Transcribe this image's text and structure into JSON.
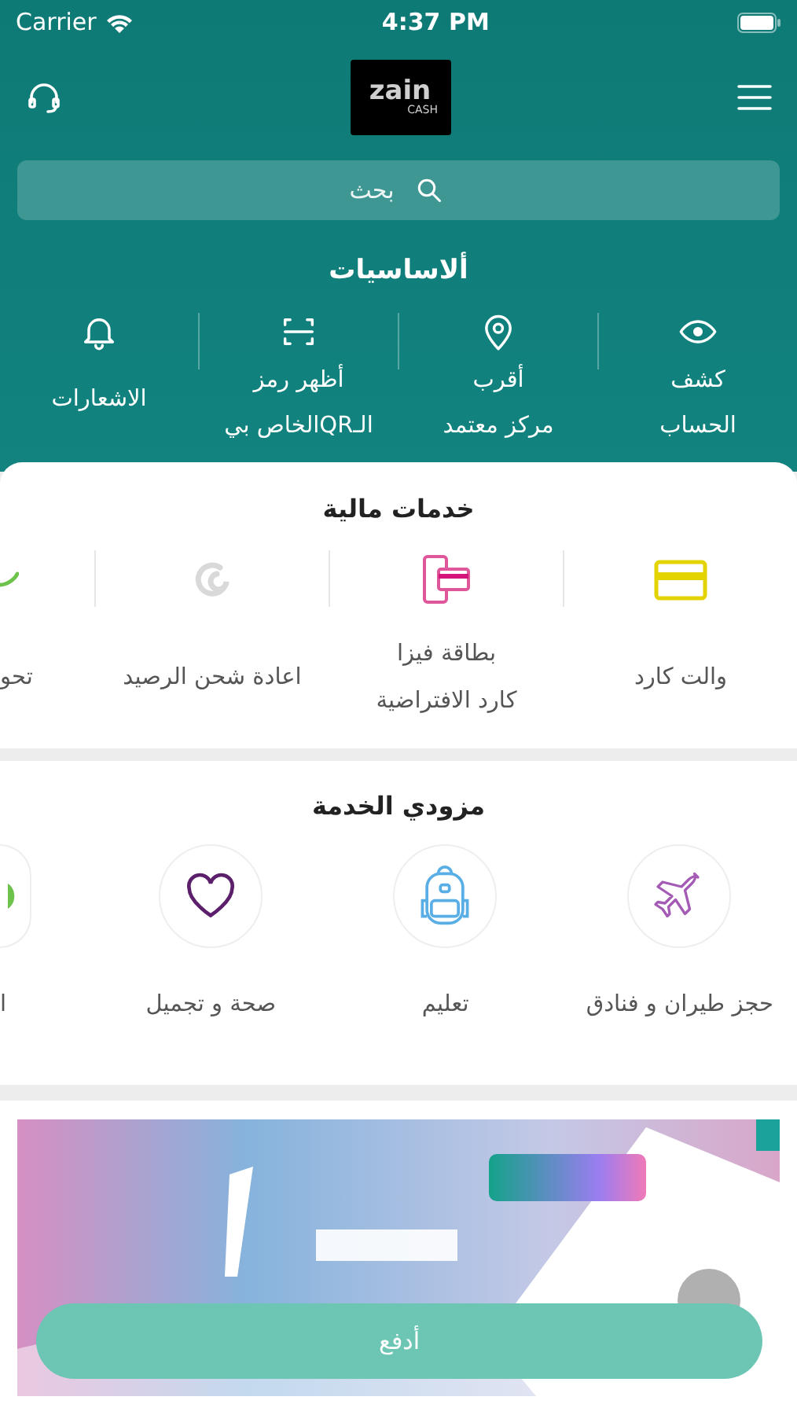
{
  "status_bar": {
    "carrier": "Carrier",
    "time": "4:37 PM"
  },
  "header": {
    "logo": {
      "brand": "zain",
      "sub": "CASH"
    }
  },
  "search": {
    "placeholder": "بحث"
  },
  "basics": {
    "title": "ألاساسيات",
    "items": [
      {
        "kind": "eye",
        "lines": [
          "كشف",
          "الحساب"
        ]
      },
      {
        "kind": "pin",
        "lines": [
          "أقرب",
          "مركز معتمد"
        ]
      },
      {
        "kind": "scan",
        "lines": [
          "أظهر رمز",
          "الـQRالخاص بي"
        ]
      },
      {
        "kind": "bell",
        "lines": [
          "الاشعارات"
        ]
      }
    ]
  },
  "financial_services": {
    "title": "خدمات مالية",
    "items": [
      {
        "kind": "card",
        "lines": [
          "والت كارد"
        ]
      },
      {
        "kind": "phone-card",
        "lines": [
          "بطاقة فيزا",
          "كارد الافتراضية"
        ]
      },
      {
        "kind": "swirl",
        "lines": [
          "اعادة شحن الرصيد"
        ]
      },
      {
        "kind": "partial",
        "lines": [
          "تحو"
        ]
      }
    ]
  },
  "service_providers": {
    "title": "مزودي الخدمة",
    "items": [
      {
        "kind": "plane",
        "label": "حجز طيران و فنادق"
      },
      {
        "kind": "backpack",
        "label": "تعليم"
      },
      {
        "kind": "heart",
        "label": "صحة و تجميل"
      },
      {
        "kind": "partial",
        "label": "ا"
      }
    ]
  },
  "pay_button": {
    "label": "أدفع"
  }
}
